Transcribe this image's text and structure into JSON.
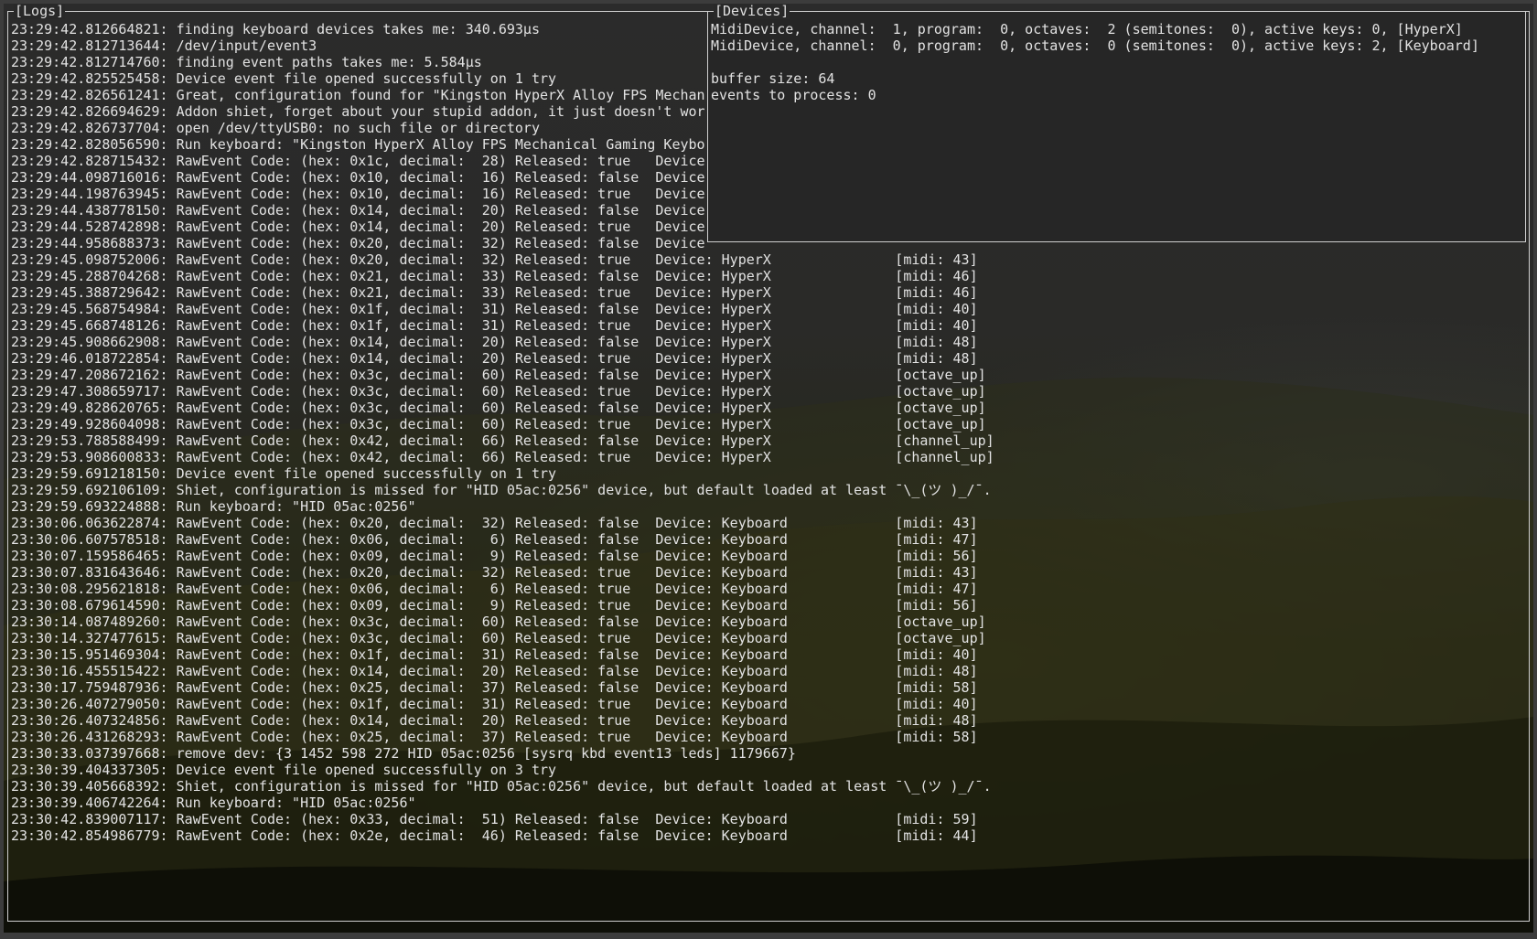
{
  "colors": {
    "text": "#e2e2e2",
    "border": "#cfcfcf",
    "devices_background": "#262626"
  },
  "logs": {
    "title": "[Logs]",
    "lines": [
      "23:29:42.812664821: finding keyboard devices takes me: 340.693µs",
      "23:29:42.812713644: /dev/input/event3",
      "23:29:42.812714760: finding event paths takes me: 5.584µs",
      "23:29:42.825525458: Device event file opened successfully on 1 try",
      "23:29:42.826561241: Great, configuration found for \"Kingston HyperX Alloy FPS Mechan",
      "23:29:42.826694629: Addon shiet, forget about your stupid addon, it just doesn't wor",
      "23:29:42.826737704: open /dev/ttyUSB0: no such file or directory",
      "23:29:42.828056590: Run keyboard: \"Kingston HyperX Alloy FPS Mechanical Gaming Keybo",
      "23:29:42.828715432: RawEvent Code: (hex: 0x1c, decimal:  28) Released: true   Device",
      "23:29:44.098716016: RawEvent Code: (hex: 0x10, decimal:  16) Released: false  Device",
      "23:29:44.198763945: RawEvent Code: (hex: 0x10, decimal:  16) Released: true   Device",
      "23:29:44.438778150: RawEvent Code: (hex: 0x14, decimal:  20) Released: false  Device",
      "23:29:44.528742898: RawEvent Code: (hex: 0x14, decimal:  20) Released: true   Device",
      "23:29:44.958688373: RawEvent Code: (hex: 0x20, decimal:  32) Released: false  Device",
      "23:29:45.098752006: RawEvent Code: (hex: 0x20, decimal:  32) Released: true   Device: HyperX               [midi: 43]",
      "23:29:45.288704268: RawEvent Code: (hex: 0x21, decimal:  33) Released: false  Device: HyperX               [midi: 46]",
      "23:29:45.388729642: RawEvent Code: (hex: 0x21, decimal:  33) Released: true   Device: HyperX               [midi: 46]",
      "23:29:45.568754984: RawEvent Code: (hex: 0x1f, decimal:  31) Released: false  Device: HyperX               [midi: 40]",
      "23:29:45.668748126: RawEvent Code: (hex: 0x1f, decimal:  31) Released: true   Device: HyperX               [midi: 40]",
      "23:29:45.908662908: RawEvent Code: (hex: 0x14, decimal:  20) Released: false  Device: HyperX               [midi: 48]",
      "23:29:46.018722854: RawEvent Code: (hex: 0x14, decimal:  20) Released: true   Device: HyperX               [midi: 48]",
      "23:29:47.208672162: RawEvent Code: (hex: 0x3c, decimal:  60) Released: false  Device: HyperX               [octave_up]",
      "23:29:47.308659717: RawEvent Code: (hex: 0x3c, decimal:  60) Released: true   Device: HyperX               [octave_up]",
      "23:29:49.828620765: RawEvent Code: (hex: 0x3c, decimal:  60) Released: false  Device: HyperX               [octave_up]",
      "23:29:49.928604098: RawEvent Code: (hex: 0x3c, decimal:  60) Released: true   Device: HyperX               [octave_up]",
      "23:29:53.788588499: RawEvent Code: (hex: 0x42, decimal:  66) Released: false  Device: HyperX               [channel_up]",
      "23:29:53.908600833: RawEvent Code: (hex: 0x42, decimal:  66) Released: true   Device: HyperX               [channel_up]",
      "23:29:59.691218150: Device event file opened successfully on 1 try",
      "23:29:59.692106109: Shiet, configuration is missed for \"HID 05ac:0256\" device, but default loaded at least ¯\\_(ツ )_/¯.",
      "23:29:59.693224888: Run keyboard: \"HID 05ac:0256\"",
      "23:30:06.063622874: RawEvent Code: (hex: 0x20, decimal:  32) Released: false  Device: Keyboard             [midi: 43]",
      "23:30:06.607578518: RawEvent Code: (hex: 0x06, decimal:   6) Released: false  Device: Keyboard             [midi: 47]",
      "23:30:07.159586465: RawEvent Code: (hex: 0x09, decimal:   9) Released: false  Device: Keyboard             [midi: 56]",
      "23:30:07.831643646: RawEvent Code: (hex: 0x20, decimal:  32) Released: true   Device: Keyboard             [midi: 43]",
      "23:30:08.295621818: RawEvent Code: (hex: 0x06, decimal:   6) Released: true   Device: Keyboard             [midi: 47]",
      "23:30:08.679614590: RawEvent Code: (hex: 0x09, decimal:   9) Released: true   Device: Keyboard             [midi: 56]",
      "23:30:14.087489260: RawEvent Code: (hex: 0x3c, decimal:  60) Released: false  Device: Keyboard             [octave_up]",
      "23:30:14.327477615: RawEvent Code: (hex: 0x3c, decimal:  60) Released: true   Device: Keyboard             [octave_up]",
      "23:30:15.951469304: RawEvent Code: (hex: 0x1f, decimal:  31) Released: false  Device: Keyboard             [midi: 40]",
      "23:30:16.455515422: RawEvent Code: (hex: 0x14, decimal:  20) Released: false  Device: Keyboard             [midi: 48]",
      "23:30:17.759487936: RawEvent Code: (hex: 0x25, decimal:  37) Released: false  Device: Keyboard             [midi: 58]",
      "23:30:26.407279050: RawEvent Code: (hex: 0x1f, decimal:  31) Released: true   Device: Keyboard             [midi: 40]",
      "23:30:26.407324856: RawEvent Code: (hex: 0x14, decimal:  20) Released: true   Device: Keyboard             [midi: 48]",
      "23:30:26.431268293: RawEvent Code: (hex: 0x25, decimal:  37) Released: true   Device: Keyboard             [midi: 58]",
      "23:30:33.037397668: remove dev: {3 1452 598 272 HID 05ac:0256 [sysrq kbd event13 leds] 1179667}",
      "23:30:39.404337305: Device event file opened successfully on 3 try",
      "23:30:39.405668392: Shiet, configuration is missed for \"HID 05ac:0256\" device, but default loaded at least ¯\\_(ツ )_/¯.",
      "23:30:39.406742264: Run keyboard: \"HID 05ac:0256\"",
      "23:30:42.839007117: RawEvent Code: (hex: 0x33, decimal:  51) Released: false  Device: Keyboard             [midi: 59]",
      "23:30:42.854986779: RawEvent Code: (hex: 0x2e, decimal:  46) Released: false  Device: Keyboard             [midi: 44]"
    ]
  },
  "devices": {
    "title": "[Devices]",
    "lines": [
      "MidiDevice, channel:  1, program:  0, octaves:  2 (semitones:  0), active keys: 0, [HyperX]",
      "MidiDevice, channel:  0, program:  0, octaves:  0 (semitones:  0), active keys: 2, [Keyboard]",
      "",
      "buffer size: 64",
      "events to process: 0"
    ]
  }
}
